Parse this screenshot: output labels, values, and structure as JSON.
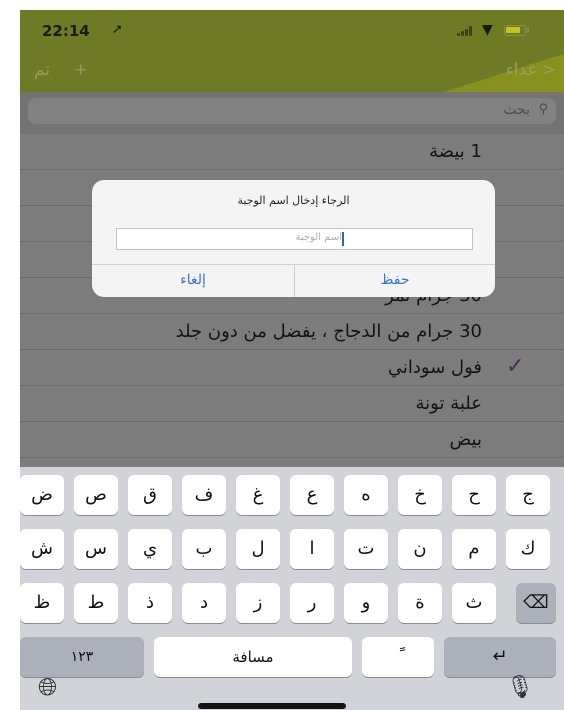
{
  "status": {
    "time": "22:14"
  },
  "nav": {
    "back_label": "غداء",
    "add_label": "+",
    "done_label": "تم"
  },
  "search": {
    "placeholder": "بحث"
  },
  "list": [
    {
      "text": "1 بيضة",
      "checked": false
    },
    {
      "text": "",
      "checked": false
    },
    {
      "text": "",
      "checked": false
    },
    {
      "text": "",
      "checked": false
    },
    {
      "text": "30 جرام تمر",
      "checked": false
    },
    {
      "text": "30 جرام من الدجاج ، يفضل من دون جلد",
      "checked": false
    },
    {
      "text": "فول سوداني",
      "checked": true
    },
    {
      "text": "علبة تونة",
      "checked": false
    },
    {
      "text": "بيض",
      "checked": false
    }
  ],
  "alert": {
    "title": "الرجاء إدخال اسم الوجبة",
    "input_placeholder": "اسم الوجبة",
    "save_label": "حفظ",
    "cancel_label": "إلغاء"
  },
  "keyboard": {
    "row1": [
      "ض",
      "ص",
      "ق",
      "ف",
      "غ",
      "ع",
      "ه",
      "خ",
      "ح",
      "ج"
    ],
    "row2": [
      "ش",
      "س",
      "ي",
      "ب",
      "ل",
      "ا",
      "ت",
      "ن",
      "م",
      "ك"
    ],
    "row3": [
      "ظ",
      "ط",
      "ذ",
      "د",
      "ز",
      "ر",
      "و",
      "ة",
      "ث"
    ],
    "numbers_label": "١٢٣",
    "space_label": "مسافة",
    "diacritic_label": "ً",
    "return_label": "↵"
  }
}
